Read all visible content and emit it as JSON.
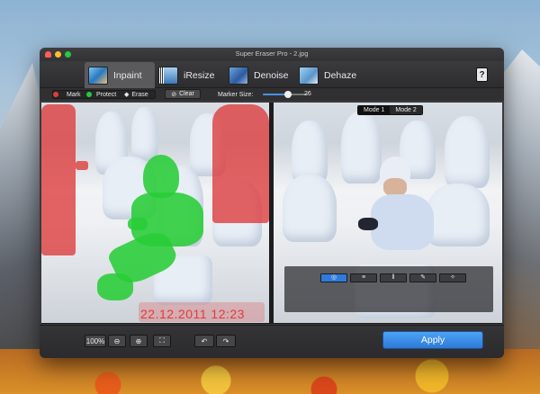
{
  "window": {
    "title": "Super Eraser Pro - 2.jpg"
  },
  "tabs": [
    {
      "label": "Inpaint",
      "icon": "inpaint-icon",
      "active": true
    },
    {
      "label": "iResize",
      "icon": "iresize-icon",
      "active": false
    },
    {
      "label": "Denoise",
      "icon": "denoise-icon",
      "active": false
    },
    {
      "label": "Dehaze",
      "icon": "dehaze-icon",
      "active": false
    }
  ],
  "help": {
    "label": "?"
  },
  "options": {
    "mark_label": "Mark",
    "protect_label": "Protect",
    "erase_label": "Erase",
    "clear_label": "Clear",
    "marker_size_label": "Marker Size:",
    "marker_size_value": "26",
    "marker_size_fraction": 0.55,
    "colors": {
      "mark": "#e23b3b",
      "protect": "#27c93f"
    }
  },
  "left_pane": {
    "watermark_text": "22.12.2011 12:23"
  },
  "right_pane": {
    "modes": [
      "Mode 1",
      "Mode 2"
    ],
    "active_mode": "Mode 1"
  },
  "overlay_tools": [
    {
      "icon": "target-icon",
      "label": "◎",
      "selected": true
    },
    {
      "icon": "stripes-icon",
      "label": "≡",
      "selected": false
    },
    {
      "icon": "pause-icon",
      "label": "‖",
      "selected": false
    },
    {
      "icon": "brush-icon",
      "label": "✎",
      "selected": false
    },
    {
      "icon": "wand-icon",
      "label": "✧",
      "selected": false
    }
  ],
  "bottom": {
    "zoom_label": "100%",
    "zoom_out_label": "⊖",
    "zoom_in_label": "⊕",
    "fit_label": "⛶",
    "undo_label": "↶",
    "redo_label": "↷",
    "apply_label": "Apply"
  }
}
